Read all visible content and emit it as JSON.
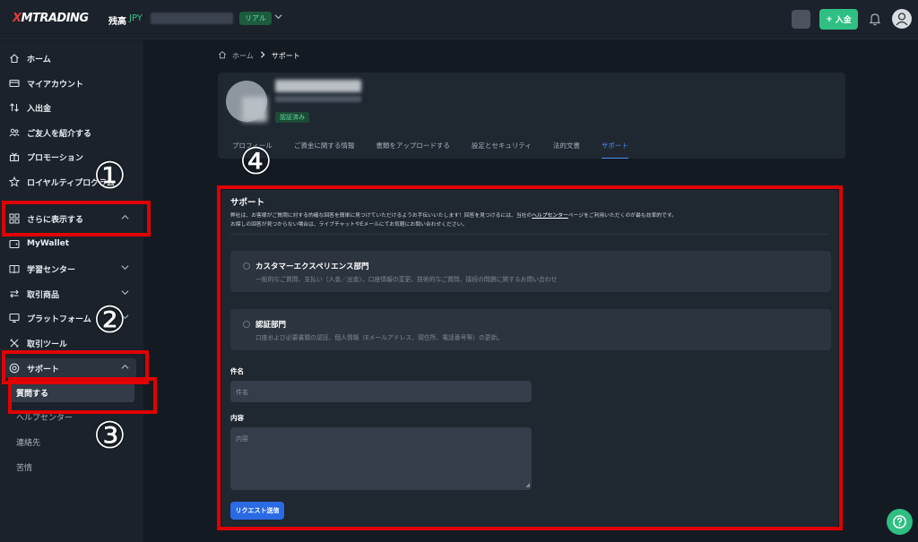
{
  "topbar": {
    "logo_mark": "X",
    "logo_text": "MTRADING",
    "balance_label": "残高",
    "balance_currency": "JPY",
    "account_badge": "リアル",
    "deposit_label": "入金",
    "deposit_plus": "+"
  },
  "sidebar": {
    "items": [
      {
        "label": "ホーム"
      },
      {
        "label": "マイアカウント"
      },
      {
        "label": "入出金"
      },
      {
        "label": "ご友人を紹介する"
      },
      {
        "label": "プロモーション"
      },
      {
        "label": "ロイヤルティプログラム"
      },
      {
        "label": "さらに表示する"
      },
      {
        "label": "MyWallet"
      },
      {
        "label": "学習センター"
      },
      {
        "label": "取引商品"
      },
      {
        "label": "プラットフォーム"
      },
      {
        "label": "取引ツール"
      },
      {
        "label": "サポート"
      }
    ],
    "support_sub": [
      {
        "label": "質問する"
      },
      {
        "label": "ヘルプセンター"
      },
      {
        "label": "連絡先"
      },
      {
        "label": "苦情"
      }
    ]
  },
  "breadcrumb": {
    "home": "ホーム",
    "current": "サポート"
  },
  "profile": {
    "verified": "認証済み",
    "tabs": [
      "プロフィール",
      "ご資金に関する情報",
      "書類をアップロードする",
      "設定とセキュリティ",
      "法的文書",
      "サポート"
    ]
  },
  "support": {
    "title": "サポート",
    "desc_a": "弊社は、お客様がご質問に対する的確な回答を簡単に見つけていただけるようお手伝いいたします！回答を見つけるには、当社の",
    "desc_link": "ヘルプセンター",
    "desc_b": "ページをご利用いただくのが最も効率的です。",
    "desc2": "お探しの回答が見つからない場合は、ライブチャットやEメールにてお気軽にお問い合わせください。",
    "options": [
      {
        "title": "カスタマーエクスペリエンス部門",
        "sub": "一般的なご質問、支払い（入金／出金）、口座情報の変更、技術的なご質問、接続の問題に関するお問い合わせ"
      },
      {
        "title": "認証部門",
        "sub": "口座および必要書類の認証、個人情報（Eメールアドレス、現住所、電話番号等）の更新。"
      }
    ],
    "subject_label": "件名",
    "subject_placeholder": "件名",
    "content_label": "内容",
    "content_placeholder": "内容",
    "submit_label": "リクエスト送信"
  },
  "annotations": [
    "①",
    "②",
    "③",
    "④"
  ],
  "colors": {
    "accent_green": "#2fbf83",
    "accent_blue": "#2a6be3",
    "annotation_red": "#e00000"
  }
}
